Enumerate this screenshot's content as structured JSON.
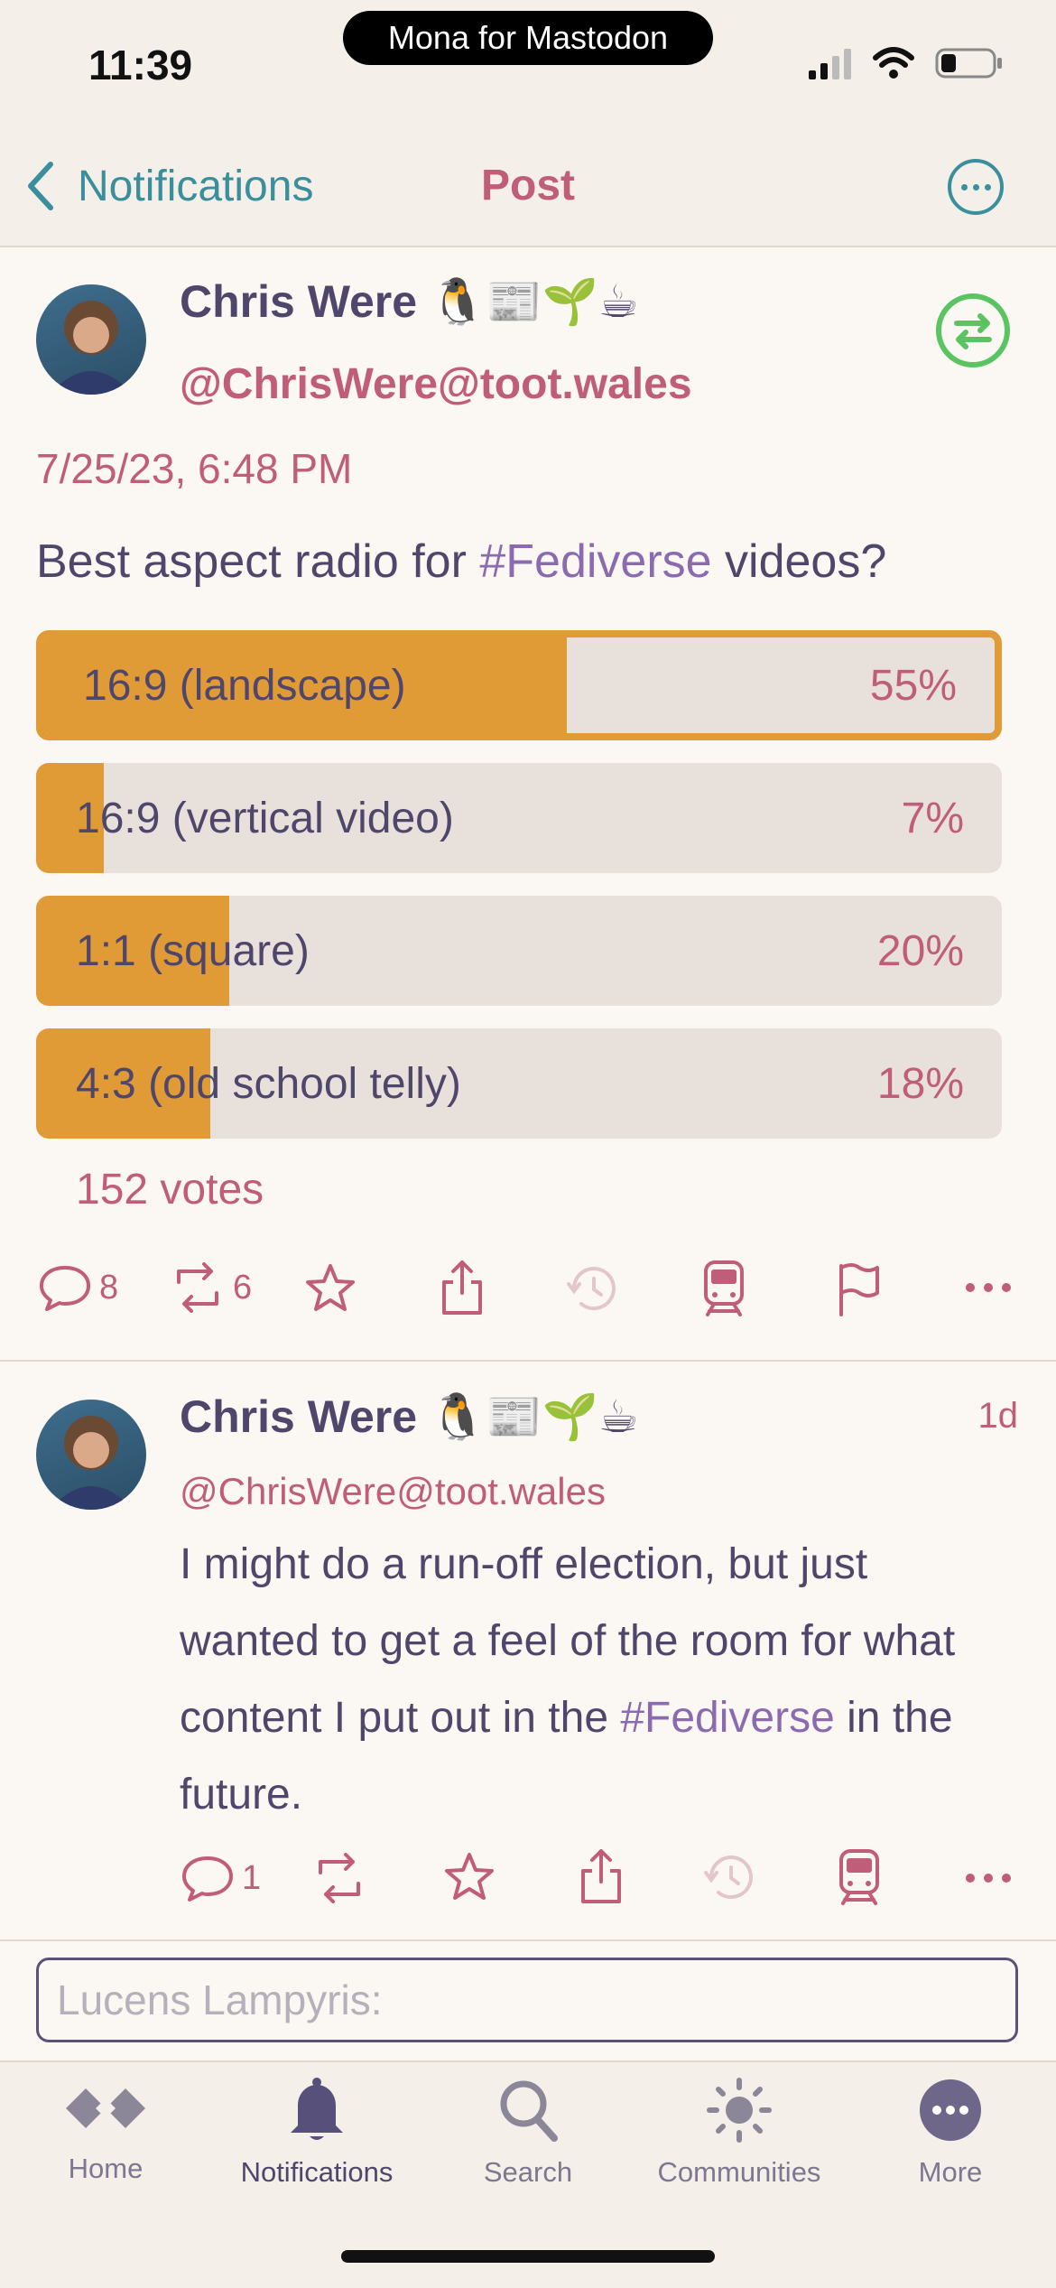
{
  "status_bar": {
    "time": "11:39",
    "app_pill": "Mona for Mastodon"
  },
  "nav": {
    "back_label": "Notifications",
    "title": "Post"
  },
  "post": {
    "author_name": "Chris Were 🐧📰🌱☕",
    "handle": "@ChrisWere@toot.wales",
    "date": "7/25/23, 6:48 PM",
    "text_before": "Best aspect radio for ",
    "hashtag": "#Fediverse",
    "text_after": " videos?",
    "poll": {
      "options": [
        {
          "label": "16:9 (landscape)",
          "percent_text": "55%",
          "fraction": 0.55,
          "selected": true
        },
        {
          "label": "16:9 (vertical video)",
          "percent_text": "7%",
          "fraction": 0.07,
          "selected": false
        },
        {
          "label": "1:1 (square)",
          "percent_text": "20%",
          "fraction": 0.2,
          "selected": false
        },
        {
          "label": "4:3 (old school telly)",
          "percent_text": "18%",
          "fraction": 0.18,
          "selected": false
        }
      ],
      "votes": "152 votes"
    },
    "actions": {
      "replies": "8",
      "boosts": "6"
    }
  },
  "reply": {
    "author_name": "Chris Were 🐧📰🌱☕",
    "handle": "@ChrisWere@toot.wales",
    "ago": "1d",
    "text_part1": "I might do a run-off election, but just wanted to get a feel of the room for what content I put out in the ",
    "hashtag": "#Fediverse",
    "text_part2": " in the future.",
    "actions": {
      "replies": "1"
    }
  },
  "compose": {
    "placeholder": "Lucens Lampyris:"
  },
  "tabs": [
    {
      "label": "Home",
      "icon": "home-icon"
    },
    {
      "label": "Notifications",
      "icon": "bell-icon"
    },
    {
      "label": "Search",
      "icon": "search-icon"
    },
    {
      "label": "Communities",
      "icon": "sun-icon"
    },
    {
      "label": "More",
      "icon": "more-icon"
    }
  ],
  "colors": {
    "accent": "#c05d78",
    "teal": "#3b8e9b",
    "poll_fill": "#e09a36",
    "text": "#4f476b"
  }
}
